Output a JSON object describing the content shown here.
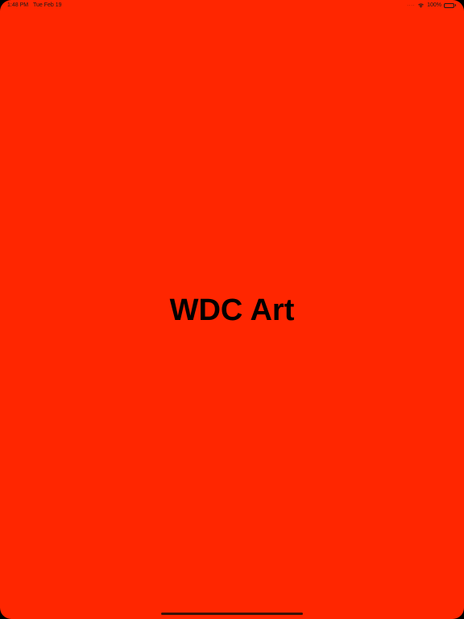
{
  "status_bar": {
    "time": "1:48 PM",
    "date": "Tue Feb 19",
    "battery_percent": "100%",
    "battery_level": 1.0,
    "icons": [
      "cellular-dots-icon",
      "wifi-icon",
      "battery-icon"
    ]
  },
  "main": {
    "title": "WDC Art"
  },
  "colors": {
    "background": "#ff2600",
    "title_text": "#000000"
  }
}
